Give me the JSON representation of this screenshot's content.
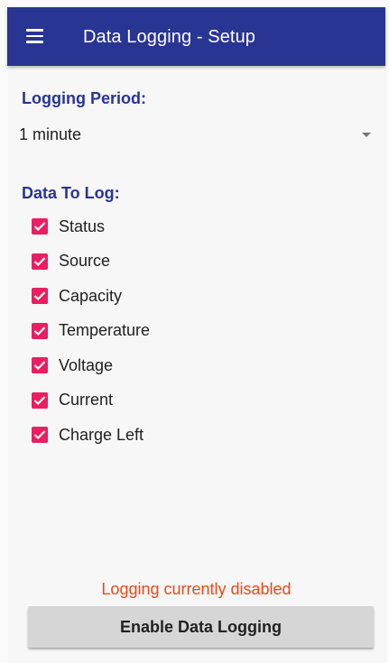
{
  "app_bar": {
    "menu_icon": "hamburger-menu-icon",
    "title": "Data Logging - Setup",
    "background_color": "#283593"
  },
  "logging_period": {
    "label": "Logging Period:",
    "selected_value": "1 minute",
    "dropdown_icon": "dropdown-arrow-icon"
  },
  "data_to_log": {
    "label": "Data To Log:",
    "checkbox_color": "#e91e63",
    "items": [
      {
        "label": "Status",
        "checked": true
      },
      {
        "label": "Source",
        "checked": true
      },
      {
        "label": "Capacity",
        "checked": true
      },
      {
        "label": "Temperature",
        "checked": true
      },
      {
        "label": "Voltage",
        "checked": true
      },
      {
        "label": "Current",
        "checked": true
      },
      {
        "label": "Charge Left",
        "checked": true
      }
    ]
  },
  "status": {
    "text": "Logging currently disabled",
    "color": "#e64a19"
  },
  "action": {
    "button_label": "Enable Data Logging"
  }
}
